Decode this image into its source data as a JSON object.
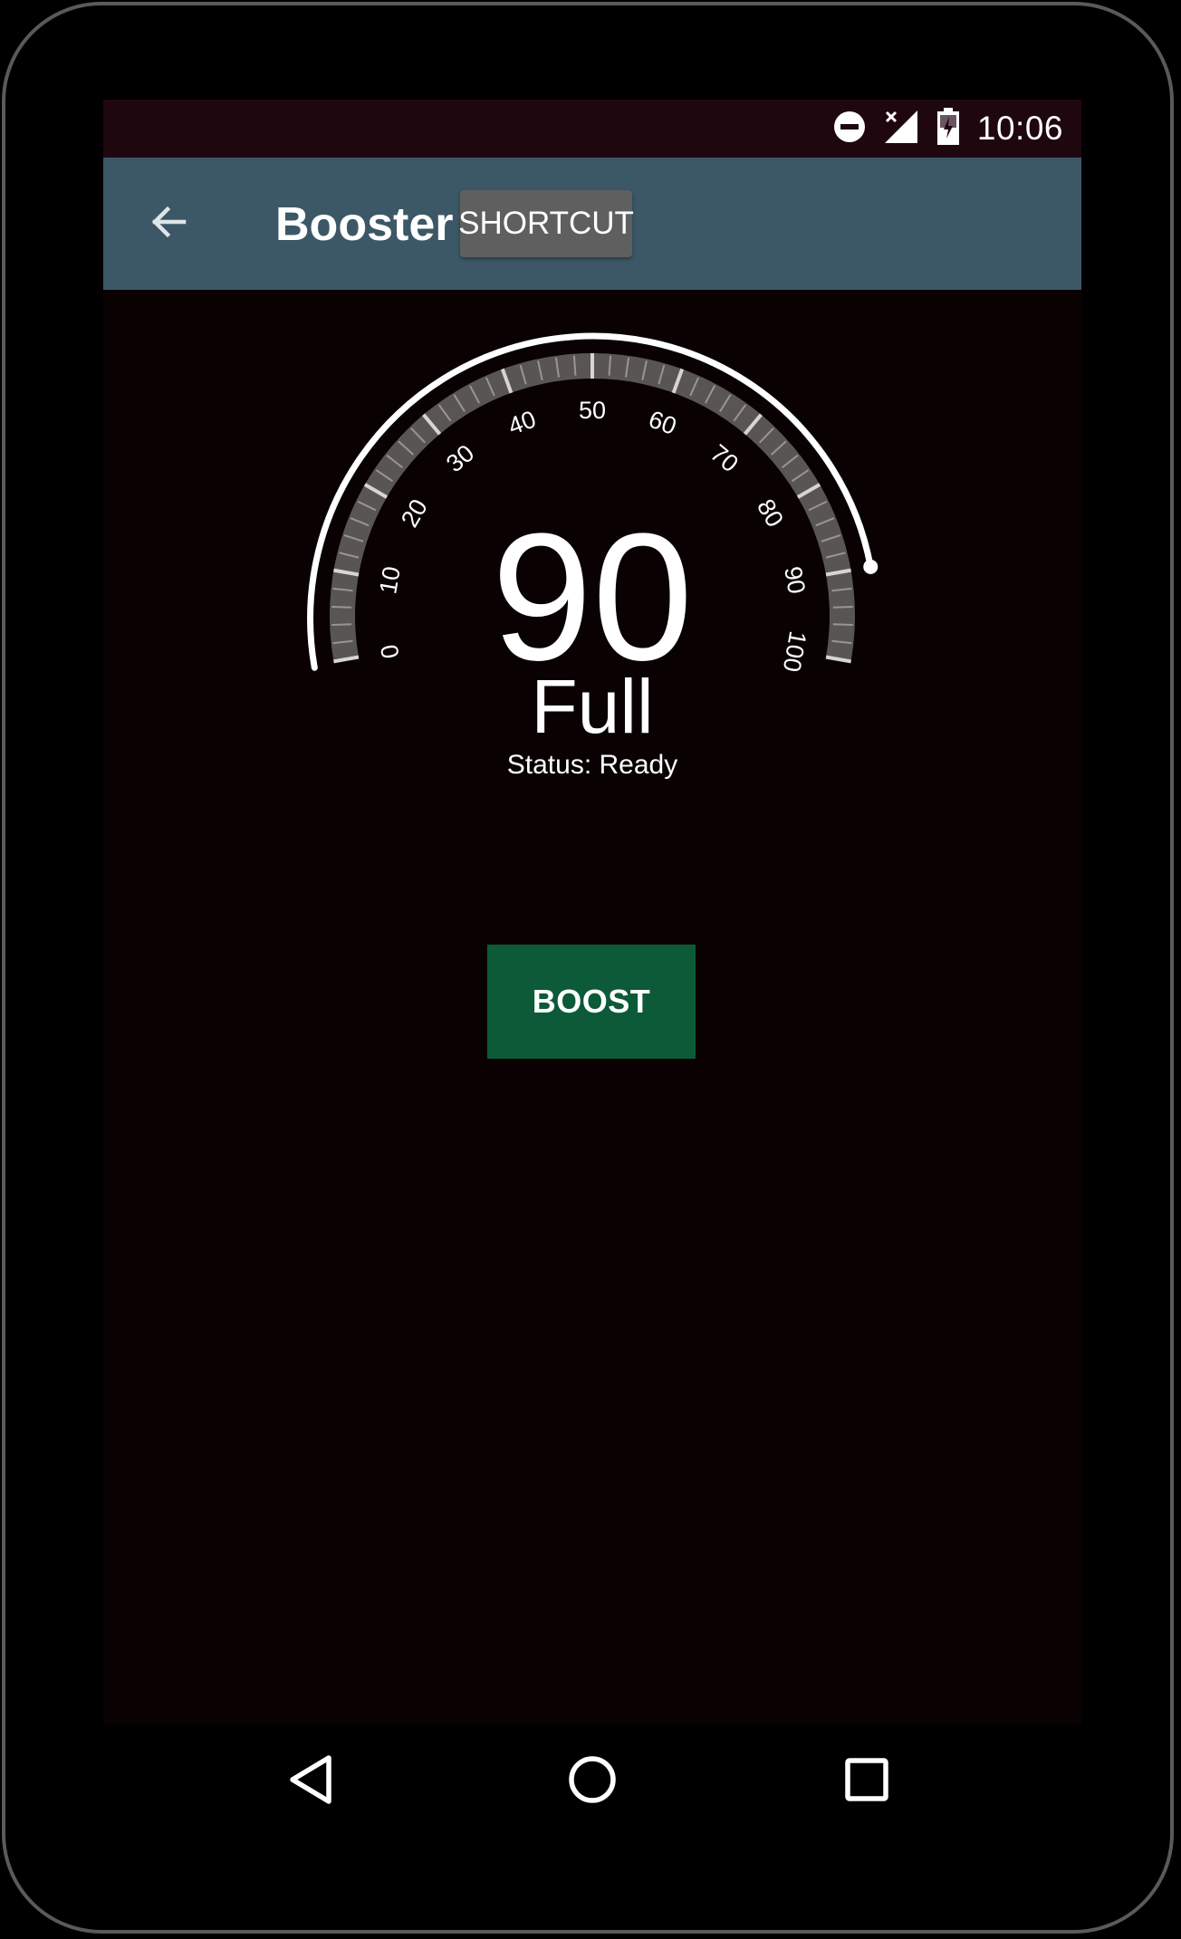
{
  "status_bar": {
    "time": "10:06",
    "icons": [
      "do-not-disturb-icon",
      "signal-no-data-icon",
      "battery-charging-icon"
    ]
  },
  "app_bar": {
    "back_icon": "arrow-back-icon",
    "title": "Booster",
    "shortcut_label": "SHORTCUT"
  },
  "gauge": {
    "value": "90",
    "label": "Full",
    "status": "Status: Ready",
    "ticks": [
      "0",
      "10",
      "20",
      "30",
      "40",
      "50",
      "60",
      "70",
      "80",
      "90",
      "100"
    ],
    "min": 0,
    "max": 100
  },
  "boost_button": {
    "label": "BOOST"
  },
  "nav_bar": {
    "icons": [
      "back-triangle-icon",
      "home-circle-icon",
      "recents-square-icon"
    ]
  },
  "colors": {
    "app_bar": "#3c5866",
    "status_bar": "#1f0710",
    "background": "#0a0202",
    "boost_button": "#0c5a38",
    "shortcut_button": "#5f5f5f",
    "gauge_band": "#5a5555"
  }
}
